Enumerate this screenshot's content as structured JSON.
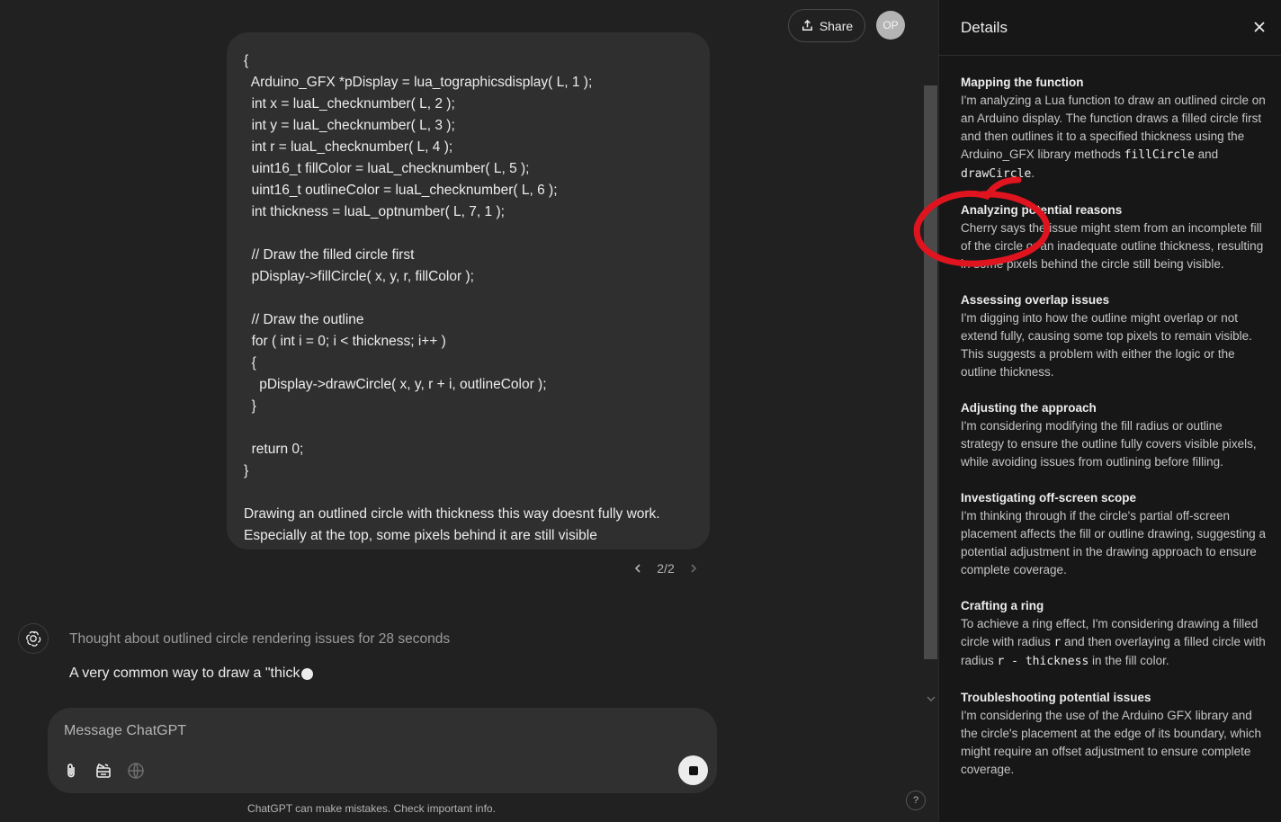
{
  "topbar": {
    "share_label": "Share",
    "avatar_initials": "OP"
  },
  "user_message": {
    "code_lines": [
      "{",
      "  Arduino_GFX *pDisplay = lua_tographicsdisplay( L, 1 );",
      "  int x = luaL_checknumber( L, 2 );",
      "  int y = luaL_checknumber( L, 3 );",
      "  int r = luaL_checknumber( L, 4 );",
      "  uint16_t fillColor = luaL_checknumber( L, 5 );",
      "  uint16_t outlineColor = luaL_checknumber( L, 6 );",
      "  int thickness = luaL_optnumber( L, 7, 1 );",
      "",
      "  // Draw the filled circle first",
      "  pDisplay->fillCircle( x, y, r, fillColor );",
      "",
      "  // Draw the outline",
      "  for ( int i = 0; i < thickness; i++ )",
      "  {",
      "    pDisplay->drawCircle( x, y, r + i, outlineColor );",
      "  }",
      "",
      "  return 0;",
      "}",
      ""
    ],
    "text_line_1": "Drawing an outlined circle with thickness this way doesnt fully work.",
    "text_line_2": "Especially at the top, some pixels behind it are still visible"
  },
  "pager": {
    "label": "2/2"
  },
  "assistant": {
    "thought_label": "Thought about outlined circle rendering issues for 28 seconds",
    "partial_answer": "A very common way to draw a \"thick"
  },
  "composer": {
    "placeholder": "Message ChatGPT"
  },
  "disclaimer": "ChatGPT can make mistakes. Check important info.",
  "help_label": "?",
  "details": {
    "title": "Details",
    "steps": [
      {
        "title": "Mapping the function",
        "text": "I'm analyzing a Lua function to draw an outlined circle on an Arduino display. The function draws a filled circle first and then outlines it to a specified thickness using the Arduino_GFX library methods ",
        "code1": "fillCircle",
        "mid": " and ",
        "code2": "drawCircle",
        "end": "."
      },
      {
        "title": "Analyzing potential reasons",
        "text": "Cherry says the issue might stem from an incomplete fill of the circle or an inadequate outline thickness, resulting in some pixels behind the circle still being visible."
      },
      {
        "title": "Assessing overlap issues",
        "text": "I'm digging into how the outline might overlap or not extend fully, causing some top pixels to remain visible. This suggests a problem with either the logic or the outline thickness."
      },
      {
        "title": "Adjusting the approach",
        "text": "I'm considering modifying the fill radius or outline strategy to ensure the outline fully covers visible pixels, while avoiding issues from outlining before filling."
      },
      {
        "title": "Investigating off-screen scope",
        "text": "I'm thinking through if the circle's partial off-screen placement affects the fill or outline drawing, suggesting a potential adjustment in the drawing approach to ensure complete coverage."
      },
      {
        "title": "Crafting a ring",
        "text": "To achieve a ring effect, I'm considering drawing a filled circle with radius ",
        "code1": "r",
        "mid": " and then overlaying a filled circle with radius ",
        "code2": "r - thickness",
        "end": " in the fill color."
      },
      {
        "title": "Troubleshooting potential issues",
        "text": "I'm considering the use of the Arduino GFX library and the circle's placement at the edge of its boundary, which might require an offset adjustment to ensure complete coverage."
      }
    ]
  },
  "colors": {
    "background": "#212121",
    "panel": "#171717",
    "bubble": "#2f2f2f",
    "annotation": "#e0141e"
  }
}
